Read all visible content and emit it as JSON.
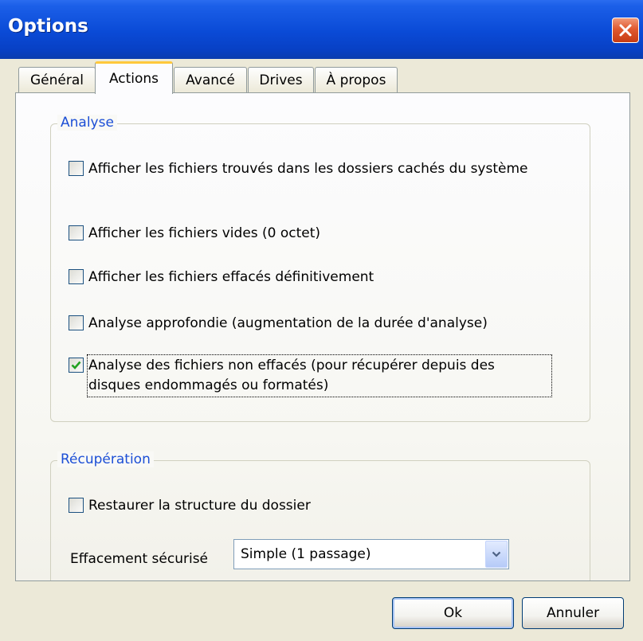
{
  "window": {
    "title": "Options"
  },
  "tabs": [
    {
      "label": "Général"
    },
    {
      "label": "Actions"
    },
    {
      "label": "Avancé"
    },
    {
      "label": "Drives"
    },
    {
      "label": "À propos"
    }
  ],
  "active_tab": "Actions",
  "analyse": {
    "title": "Analyse",
    "options": [
      {
        "label": "Afficher les fichiers trouvés dans les dossiers cachés du système",
        "checked": false
      },
      {
        "label": "Afficher les fichiers vides (0 octet)",
        "checked": false
      },
      {
        "label": "Afficher les fichiers effacés définitivement",
        "checked": false
      },
      {
        "label": "Analyse approfondie (augmentation de la durée d'analyse)",
        "checked": false
      },
      {
        "label": "Analyse des fichiers non effacés (pour récupérer depuis des disques endommagés ou formatés)",
        "checked": true
      }
    ]
  },
  "recuperation": {
    "title": "Récupération",
    "restore_structure": {
      "label": "Restaurer la structure du dossier",
      "checked": false
    },
    "secure_erase": {
      "label": "Effacement sécurisé",
      "value": "Simple (1 passage)"
    }
  },
  "buttons": {
    "ok": "Ok",
    "cancel": "Annuler"
  },
  "colors": {
    "titlebar": "#0a4ad6",
    "group_title": "#1c4fd6",
    "tab_highlight": "#ffc83c",
    "close": "#e0592f",
    "checkmark": "#21a121"
  }
}
